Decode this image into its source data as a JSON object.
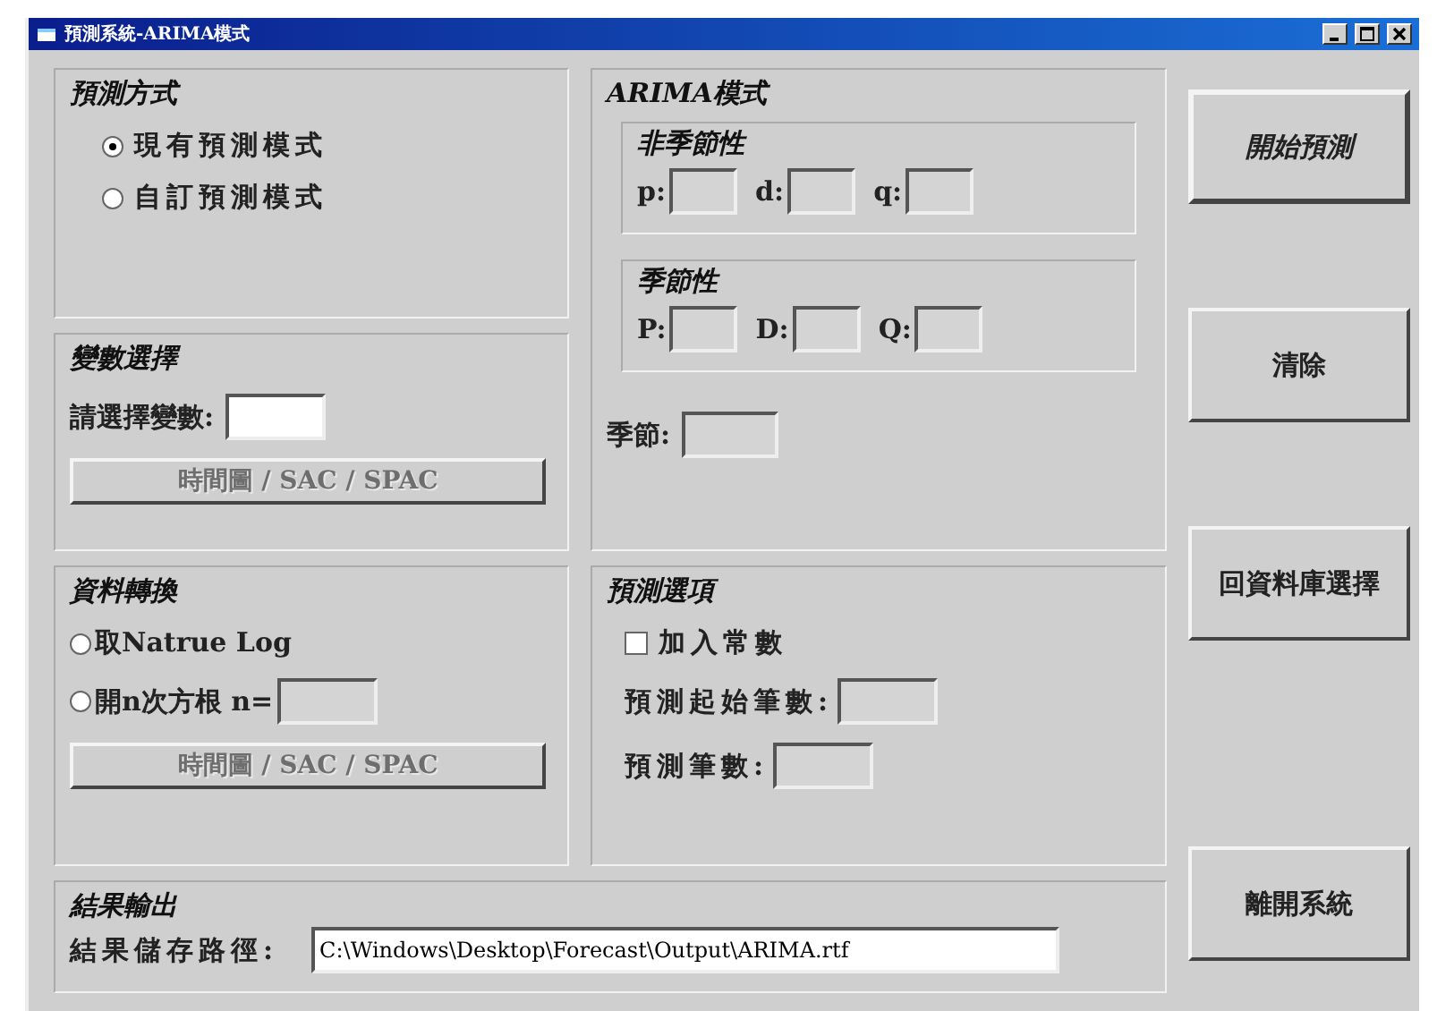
{
  "window": {
    "title": "預測系統-ARIMA模式"
  },
  "method": {
    "title": "預測方式",
    "options": [
      {
        "label": "現有預測模式",
        "selected": true
      },
      {
        "label": "自訂預測模式",
        "selected": false
      }
    ]
  },
  "variable": {
    "title": "變數選擇",
    "label": "請選擇變數:",
    "button": {
      "label": "時間圖 / SAC / SPAC",
      "disabled": true
    }
  },
  "arima": {
    "title": "ARIMA模式",
    "nonseasonal": {
      "title": "非季節性",
      "fields": [
        {
          "label": "p:"
        },
        {
          "label": "d:"
        },
        {
          "label": "q:"
        }
      ]
    },
    "seasonal": {
      "title": "季節性",
      "fields": [
        {
          "label": "P:"
        },
        {
          "label": "D:"
        },
        {
          "label": "Q:"
        }
      ]
    },
    "season_label": "季節:"
  },
  "transform": {
    "title": "資料轉換",
    "options": [
      {
        "label": "取Natrue Log",
        "selected": false
      },
      {
        "label": "開n次方根 n=",
        "selected": false
      }
    ],
    "button": {
      "label": "時間圖 / SAC / SPAC",
      "disabled": true
    }
  },
  "forecast_options": {
    "title": "預測選項",
    "constant": {
      "label": "加入常數",
      "checked": false
    },
    "fields": [
      {
        "label": "預測起始筆數:"
      },
      {
        "label": "預測筆數:"
      }
    ]
  },
  "output": {
    "title": "結果輸出",
    "label": "結果儲存路徑:",
    "value": "C:\\Windows\\Desktop\\Forecast\\Output\\ARIMA.rtf"
  },
  "buttons": [
    {
      "label": "開始預測",
      "default": true
    },
    {
      "label": "清除",
      "default": false
    },
    {
      "label": "回資料庫選擇",
      "default": false
    },
    {
      "label": "離開系統",
      "default": false
    }
  ]
}
